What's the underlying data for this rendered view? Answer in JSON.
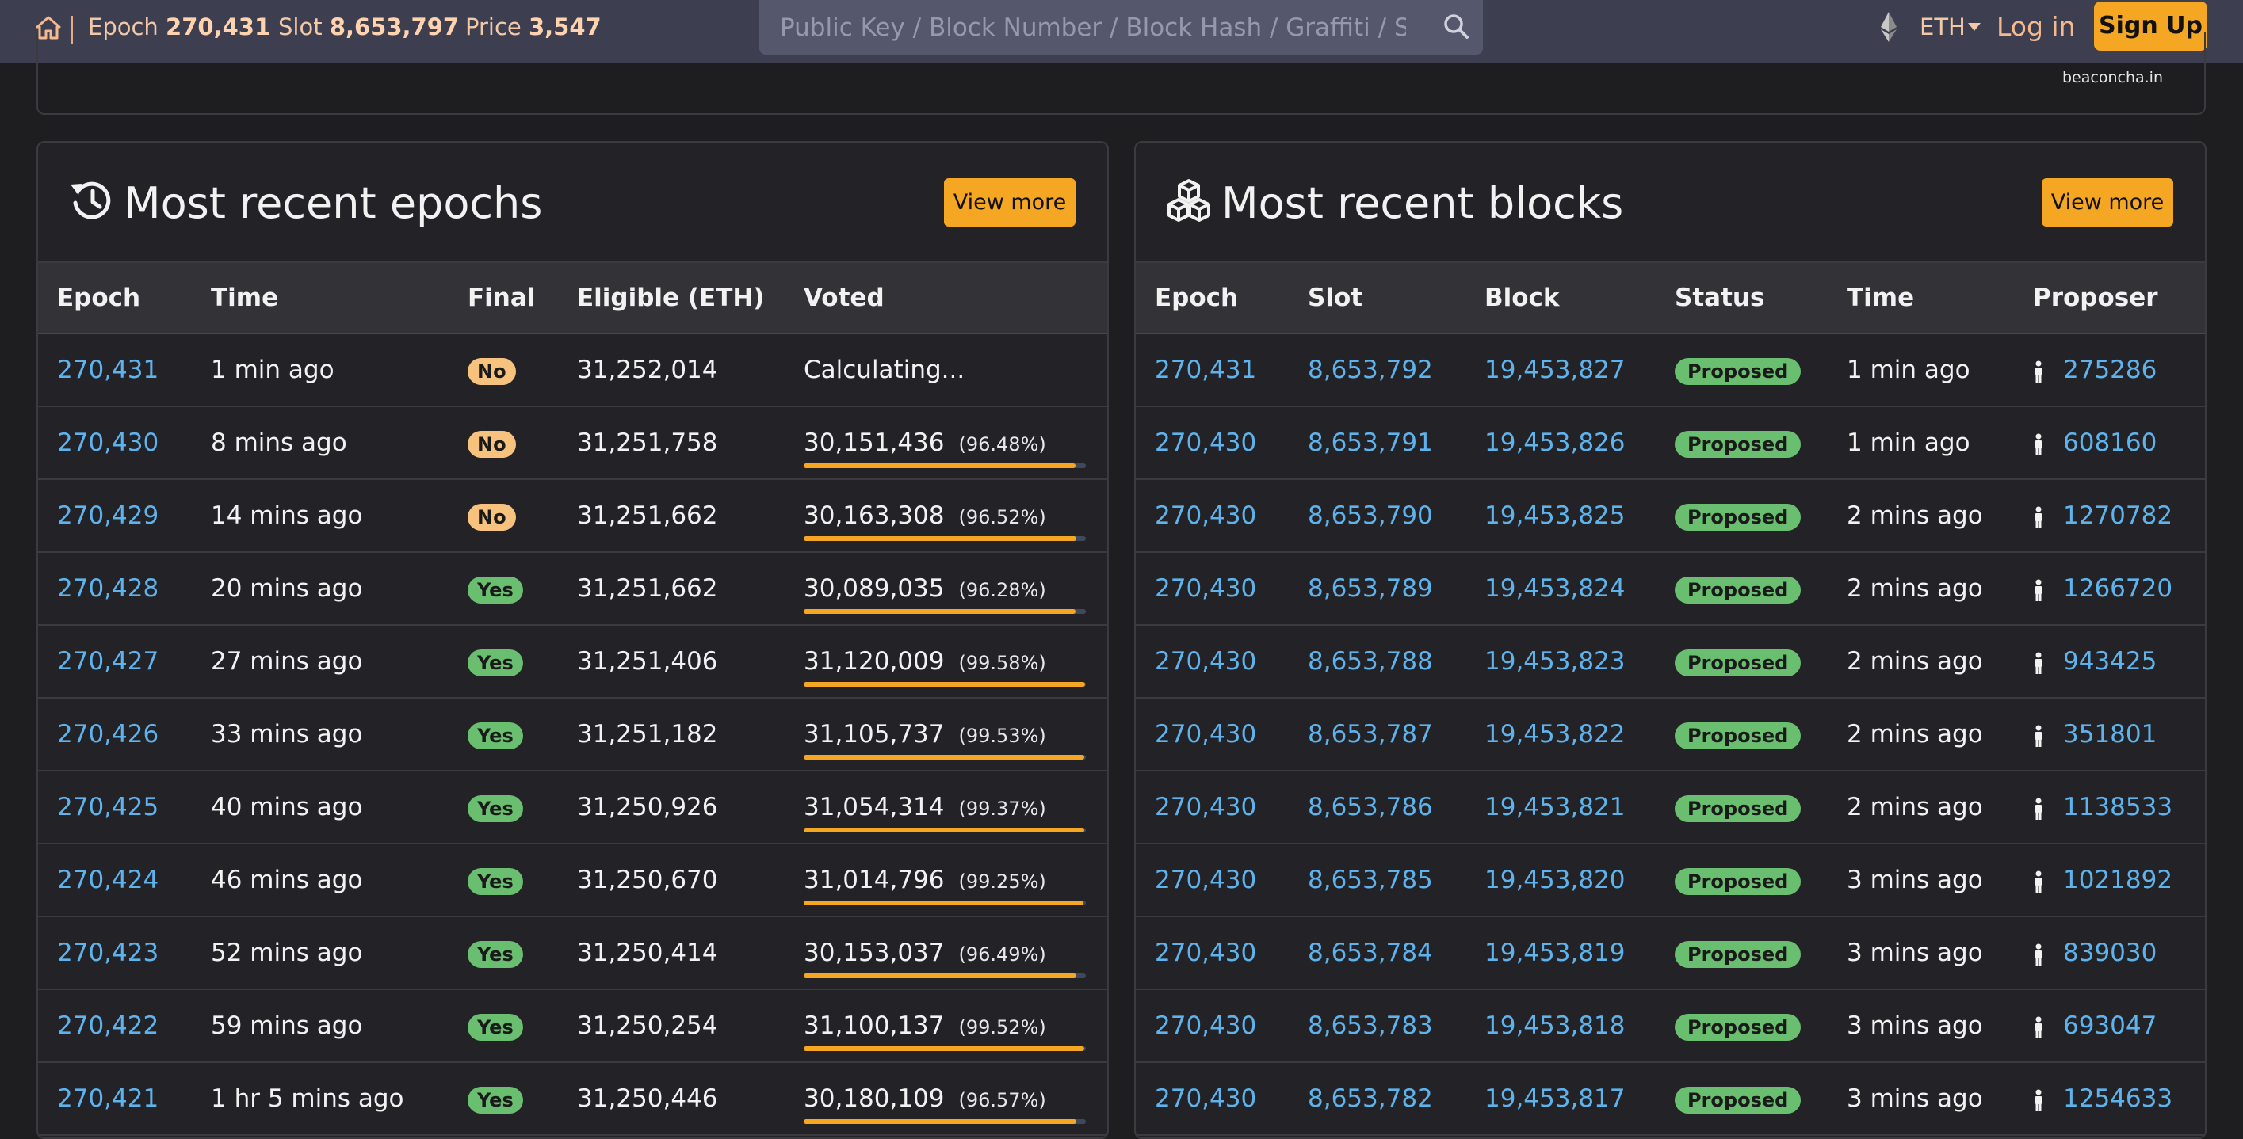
{
  "nav": {
    "epoch_label": "Epoch",
    "epoch_value": "270,431",
    "slot_label": "Slot",
    "slot_value": "8,653,797",
    "price_label": "Price",
    "price_value": "3,547",
    "search_placeholder": "Public Key / Block Number / Block Hash / Graffiti / State",
    "currency": "ETH",
    "login_label": "Log in",
    "signup_label": "Sign Up"
  },
  "attribution": "beaconcha.in",
  "colors": {
    "accent": "#f5a623",
    "link": "#5fb3ec",
    "badge_yes": "#69be6f",
    "badge_no": "#f7c27e"
  },
  "epochs": {
    "title": "Most recent epochs",
    "title_icon": "history-icon",
    "view_more_label": "View more",
    "columns": [
      "Epoch",
      "Time",
      "Final",
      "Eligible (ETH)",
      "Voted"
    ],
    "rows": [
      {
        "epoch": "270,431",
        "time": "1 min ago",
        "final": "No",
        "eligible": "31,252,014",
        "voted": "Calculating...",
        "pct": "",
        "progress": null
      },
      {
        "epoch": "270,430",
        "time": "8 mins ago",
        "final": "No",
        "eligible": "31,251,758",
        "voted": "30,151,436",
        "pct": "(96.48%)",
        "progress": 0.9648
      },
      {
        "epoch": "270,429",
        "time": "14 mins ago",
        "final": "No",
        "eligible": "31,251,662",
        "voted": "30,163,308",
        "pct": "(96.52%)",
        "progress": 0.9652
      },
      {
        "epoch": "270,428",
        "time": "20 mins ago",
        "final": "Yes",
        "eligible": "31,251,662",
        "voted": "30,089,035",
        "pct": "(96.28%)",
        "progress": 0.9628
      },
      {
        "epoch": "270,427",
        "time": "27 mins ago",
        "final": "Yes",
        "eligible": "31,251,406",
        "voted": "31,120,009",
        "pct": "(99.58%)",
        "progress": 0.9958
      },
      {
        "epoch": "270,426",
        "time": "33 mins ago",
        "final": "Yes",
        "eligible": "31,251,182",
        "voted": "31,105,737",
        "pct": "(99.53%)",
        "progress": 0.9953
      },
      {
        "epoch": "270,425",
        "time": "40 mins ago",
        "final": "Yes",
        "eligible": "31,250,926",
        "voted": "31,054,314",
        "pct": "(99.37%)",
        "progress": 0.9937
      },
      {
        "epoch": "270,424",
        "time": "46 mins ago",
        "final": "Yes",
        "eligible": "31,250,670",
        "voted": "31,014,796",
        "pct": "(99.25%)",
        "progress": 0.9925
      },
      {
        "epoch": "270,423",
        "time": "52 mins ago",
        "final": "Yes",
        "eligible": "31,250,414",
        "voted": "30,153,037",
        "pct": "(96.49%)",
        "progress": 0.9649
      },
      {
        "epoch": "270,422",
        "time": "59 mins ago",
        "final": "Yes",
        "eligible": "31,250,254",
        "voted": "31,100,137",
        "pct": "(99.52%)",
        "progress": 0.9952
      },
      {
        "epoch": "270,421",
        "time": "1 hr 5 mins ago",
        "final": "Yes",
        "eligible": "31,250,446",
        "voted": "30,180,109",
        "pct": "(96.57%)",
        "progress": 0.9657
      }
    ]
  },
  "blocks": {
    "title": "Most recent blocks",
    "title_icon": "cubes-icon",
    "view_more_label": "View more",
    "columns": [
      "Epoch",
      "Slot",
      "Block",
      "Status",
      "Time",
      "Proposer"
    ],
    "rows": [
      {
        "epoch": "270,431",
        "slot": "8,653,792",
        "block": "19,453,827",
        "status": "Proposed",
        "time": "1 min ago",
        "proposer": "275286"
      },
      {
        "epoch": "270,430",
        "slot": "8,653,791",
        "block": "19,453,826",
        "status": "Proposed",
        "time": "1 min ago",
        "proposer": "608160"
      },
      {
        "epoch": "270,430",
        "slot": "8,653,790",
        "block": "19,453,825",
        "status": "Proposed",
        "time": "2 mins ago",
        "proposer": "1270782"
      },
      {
        "epoch": "270,430",
        "slot": "8,653,789",
        "block": "19,453,824",
        "status": "Proposed",
        "time": "2 mins ago",
        "proposer": "1266720"
      },
      {
        "epoch": "270,430",
        "slot": "8,653,788",
        "block": "19,453,823",
        "status": "Proposed",
        "time": "2 mins ago",
        "proposer": "943425"
      },
      {
        "epoch": "270,430",
        "slot": "8,653,787",
        "block": "19,453,822",
        "status": "Proposed",
        "time": "2 mins ago",
        "proposer": "351801"
      },
      {
        "epoch": "270,430",
        "slot": "8,653,786",
        "block": "19,453,821",
        "status": "Proposed",
        "time": "2 mins ago",
        "proposer": "1138533"
      },
      {
        "epoch": "270,430",
        "slot": "8,653,785",
        "block": "19,453,820",
        "status": "Proposed",
        "time": "3 mins ago",
        "proposer": "1021892"
      },
      {
        "epoch": "270,430",
        "slot": "8,653,784",
        "block": "19,453,819",
        "status": "Proposed",
        "time": "3 mins ago",
        "proposer": "839030"
      },
      {
        "epoch": "270,430",
        "slot": "8,653,783",
        "block": "19,453,818",
        "status": "Proposed",
        "time": "3 mins ago",
        "proposer": "693047"
      },
      {
        "epoch": "270,430",
        "slot": "8,653,782",
        "block": "19,453,817",
        "status": "Proposed",
        "time": "3 mins ago",
        "proposer": "1254633"
      }
    ]
  }
}
